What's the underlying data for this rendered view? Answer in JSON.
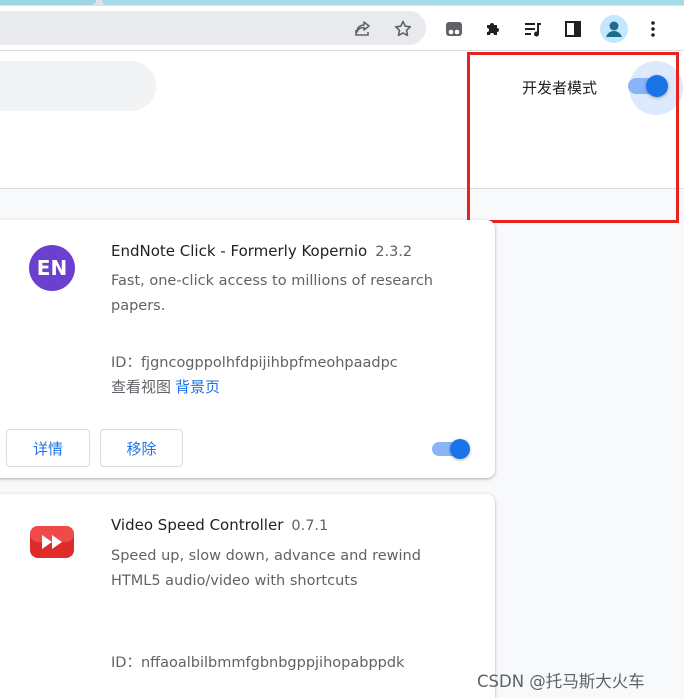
{
  "toolbar": {
    "icons": [
      "share-icon",
      "bookmark-star-icon",
      "tab-search-icon",
      "extensions-puzzle-icon",
      "media-controls-icon",
      "side-panel-icon",
      "profile-avatar-icon",
      "more-menu-icon"
    ]
  },
  "header": {
    "developer_mode_label": "开发者模式",
    "developer_mode_enabled": true
  },
  "extensions": [
    {
      "logo_text": "EN",
      "logo_color": "#6b3fd0",
      "name": "EndNote Click - Formerly Kopernio",
      "version": "2.3.2",
      "description": "Fast, one-click access to millions of research papers.",
      "id_line": "ID：fjgncogppolhfdpijihbpfmeohpaadpc",
      "inspect_views_label": "查看视图",
      "background_page_link": "背景页",
      "details_button": "详情",
      "remove_button": "移除",
      "enabled": true
    },
    {
      "logo_icon": "video-speed-controller-logo-icon",
      "logo_color": "#e02b2b",
      "name": "Video Speed Controller",
      "version": "0.7.1",
      "description": "Speed up, slow down, advance and rewind HTML5 audio/video with shortcuts",
      "id_line": "ID：nffaoalbilbmmfgbnbgppjihopabppdk"
    }
  ],
  "colors": {
    "accent_blue": "#1a73e8",
    "highlight_red": "#e8231d"
  },
  "watermark": "CSDN @托马斯大火车"
}
